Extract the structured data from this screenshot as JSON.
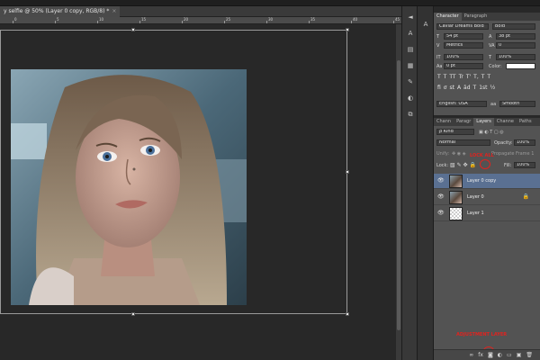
{
  "document": {
    "tab_title": "y selfie @ 50% (Layer 0 copy, RGB/8) *",
    "ruler_numbers": [
      "0",
      "5",
      "10",
      "15",
      "20",
      "25",
      "30",
      "35",
      "40",
      "45"
    ]
  },
  "tools": [
    {
      "name": "move-tool-icon",
      "glyph": "◄"
    },
    {
      "name": "character-panel-icon",
      "glyph": "A"
    },
    {
      "name": "histogram-icon",
      "glyph": "▤"
    },
    {
      "name": "swatches-icon",
      "glyph": "▦"
    },
    {
      "name": "brush-presets-icon",
      "glyph": "✎"
    },
    {
      "name": "adjustments-icon",
      "glyph": "◐"
    },
    {
      "name": "layer-comps-icon",
      "glyph": "⧉"
    }
  ],
  "character_panel": {
    "tabs": [
      "Character",
      "Paragraph"
    ],
    "font_family": "Caviar Dreams Bold",
    "font_style": "Bold",
    "font_size": "54 pt",
    "leading": "38 pt",
    "kerning": "Metrics",
    "tracking": "0",
    "vertical_scale": "100%",
    "horizontal_scale": "100%",
    "baseline_shift": "0 pt",
    "color_label": "Color:",
    "type_styles": [
      "T",
      "T",
      "TT",
      "Tr",
      "T'",
      "T,",
      "T",
      "T"
    ],
    "opentype": [
      "fi",
      "ơ",
      "st",
      "A",
      "ād",
      "T",
      "1st",
      "½"
    ],
    "language": "English: USA",
    "aa_icon": "aa",
    "antialias": "Smooth"
  },
  "layers_panel": {
    "tabs": [
      "Chann",
      "Paragr",
      "Layers",
      "Channe",
      "Paths"
    ],
    "kind_filter": "ρ Kind",
    "blend_mode": "Normal",
    "opacity_label": "Opacity:",
    "opacity_value": "100%",
    "unify_label": "Unify:",
    "propagate_label": "Propagate Frame 1",
    "lock_label": "Lock:",
    "fill_label": "Fill:",
    "fill_value": "100%",
    "layers": [
      {
        "name": "Layer 0 copy",
        "selected": true,
        "locked": false
      },
      {
        "name": "Layer 0",
        "selected": false,
        "locked": true
      },
      {
        "name": "Layer 1",
        "selected": false,
        "locked": false
      }
    ],
    "annotation_lock": "LOCK ALL",
    "annotation_adjustment": "ADJUSTMENT LAYER",
    "bottom_icons": [
      "link-layers-icon",
      "fx-icon",
      "mask-icon",
      "adjustment-layer-icon",
      "group-icon",
      "new-layer-icon",
      "delete-icon"
    ],
    "bottom_glyphs": [
      "∞",
      "fx",
      "◙",
      "◐",
      "▭",
      "▣",
      "🗑"
    ]
  },
  "colors": {
    "accent_red": "#e0231f",
    "selected_layer": "#5a7092"
  }
}
